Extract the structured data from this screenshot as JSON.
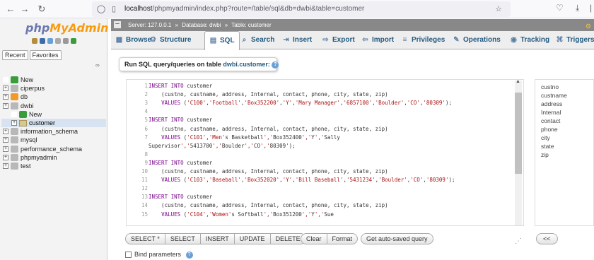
{
  "browser": {
    "url_host": "localhost",
    "url_path": "/phpmyadmin/index.php?route=/table/sql&db=dwbi&table=customer"
  },
  "logo": {
    "part1": "php",
    "part2": "MyAdmin"
  },
  "left": {
    "recent_tab": "Recent",
    "favorites_tab": "Favorites",
    "tree": [
      {
        "label": "New",
        "kind": "new",
        "indent": 0
      },
      {
        "label": "ciperpus",
        "kind": "db",
        "indent": 0
      },
      {
        "label": "db",
        "kind": "db-orange",
        "indent": 0
      },
      {
        "label": "dwbi",
        "kind": "db",
        "indent": 0
      },
      {
        "label": "New",
        "kind": "new",
        "indent": 1
      },
      {
        "label": "customer",
        "kind": "table",
        "indent": 1,
        "selected": true
      },
      {
        "label": "information_schema",
        "kind": "db",
        "indent": 0
      },
      {
        "label": "mysql",
        "kind": "db",
        "indent": 0
      },
      {
        "label": "performance_schema",
        "kind": "db",
        "indent": 0
      },
      {
        "label": "phpmyadmin",
        "kind": "db",
        "indent": 0
      },
      {
        "label": "test",
        "kind": "db",
        "indent": 0
      }
    ]
  },
  "breadcrumb": {
    "server": "Server: 127.0.0.1",
    "database": "Database: dwbi",
    "table": "Table: customer",
    "separator": "»"
  },
  "tabs": [
    {
      "label": "Browse",
      "icon": "▦",
      "name": "tab-browse"
    },
    {
      "label": "Structure",
      "icon": "⚙",
      "name": "tab-structure"
    },
    {
      "label": "SQL",
      "icon": "▤",
      "name": "tab-sql",
      "active": true
    },
    {
      "label": "Search",
      "icon": "⌕",
      "name": "tab-search"
    },
    {
      "label": "Insert",
      "icon": "⇥",
      "name": "tab-insert"
    },
    {
      "label": "Export",
      "icon": "⇨",
      "name": "tab-export"
    },
    {
      "label": "Import",
      "icon": "⇦",
      "name": "tab-import"
    },
    {
      "label": "Privileges",
      "icon": "≡",
      "name": "tab-privileges"
    },
    {
      "label": "Operations",
      "icon": "✎",
      "name": "tab-operations"
    },
    {
      "label": "Tracking",
      "icon": "◉",
      "name": "tab-tracking"
    },
    {
      "label": "Triggers",
      "icon": "⌘",
      "name": "tab-triggers"
    }
  ],
  "sql": {
    "header_prefix": "Run SQL query/queries on table",
    "table_ref": "dwbi.customer:",
    "lines": [
      {
        "n": "1",
        "t": "INSERT INTO customer"
      },
      {
        "n": "2",
        "t": "    (custno, custname, address, Internal, contact, phone, city, state, zip)"
      },
      {
        "n": "3",
        "t": "    VALUES ('C100','Football','Box352200','Y','Mary Manager','6857100','Boulder','CO','80309');"
      },
      {
        "n": "4",
        "t": ""
      },
      {
        "n": "5",
        "t": "INSERT INTO customer"
      },
      {
        "n": "6",
        "t": "    (custno, custname, address, Internal, contact, phone, city, state, zip)"
      },
      {
        "n": "7",
        "t": "    VALUES ('C101','Men's Basketball','Box352400','Y','Sally"
      },
      {
        "n": "",
        "t": "Supervisor','5413700','Boulder','CO','80309');"
      },
      {
        "n": "8",
        "t": ""
      },
      {
        "n": "9",
        "t": "INSERT INTO customer"
      },
      {
        "n": "10",
        "t": "    (custno, custname, address, Internal, contact, phone, city, state, zip)"
      },
      {
        "n": "11",
        "t": "    VALUES ('C103','Baseball','Box352020','Y','Bill Baseball','5431234','Boulder','CO','80309');"
      },
      {
        "n": "12",
        "t": ""
      },
      {
        "n": "13",
        "t": "INSERT INTO customer"
      },
      {
        "n": "14",
        "t": "    (custno, custname, address, Internal, contact, phone, city, state, zip)"
      },
      {
        "n": "15",
        "t": "    VALUES ('C104','Women's Softball','Box351200','Y','Sue"
      }
    ]
  },
  "columns": [
    "custno",
    "custname",
    "address",
    "Internal",
    "contact",
    "phone",
    "city",
    "state",
    "zip"
  ],
  "buttons": {
    "select_star": "SELECT *",
    "select": "SELECT",
    "insert": "INSERT",
    "update": "UPDATE",
    "delete": "DELETE",
    "clear": "Clear",
    "format": "Format",
    "auto_saved": "Get auto-saved query",
    "insert_col": "<<"
  },
  "bind_params": "Bind parameters"
}
